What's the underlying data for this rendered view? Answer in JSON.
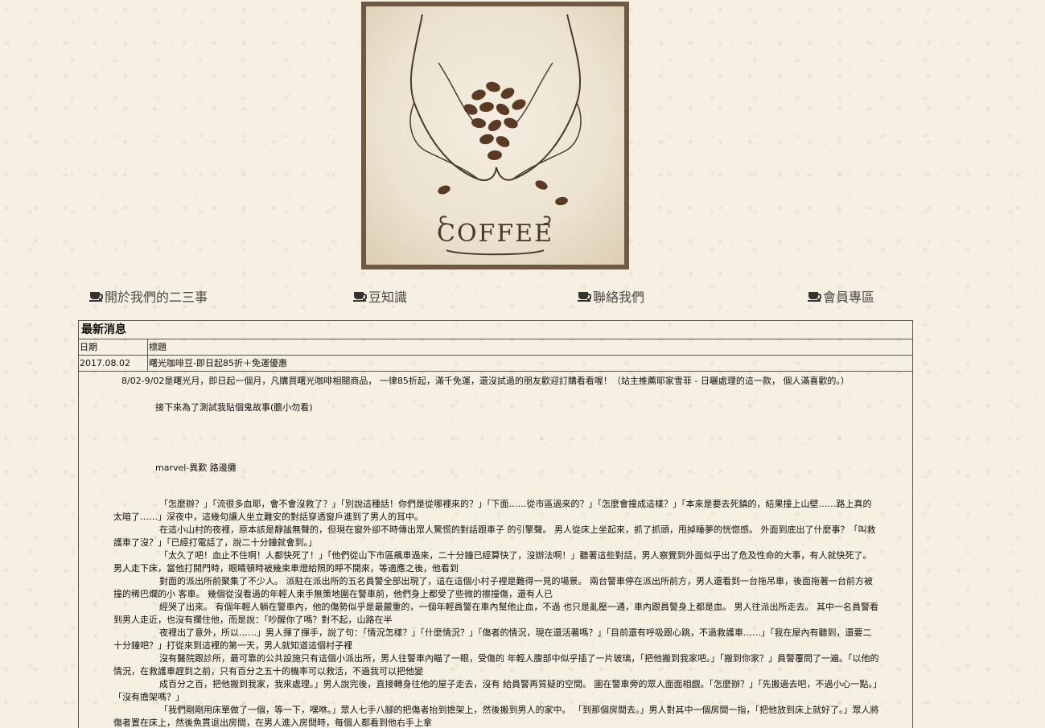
{
  "banner": {
    "text": "COFFEE"
  },
  "nav": {
    "items": [
      {
        "label": "開於我們的二三事"
      },
      {
        "label": "豆知識"
      },
      {
        "label": "聯絡我們"
      },
      {
        "label": "會員專區"
      }
    ]
  },
  "news": {
    "title": "最新消息",
    "columns": {
      "date": "日期",
      "title": "標題"
    },
    "rows": [
      {
        "date": "2017.08.02",
        "title": "曙光咖啡豆-即日起85折＋免運優惠"
      }
    ],
    "intro": "8/02-9/02是曙光月，即日起一個月，凡購買曙光咖啡相關商品， 一律85折起，滿千免運，還沒試過的朋友歡迎訂購看看喔！（站主推薦耶家雪菲 - 日曬處理的這一款， 個人滿喜歡的。）",
    "test_line": "接下來為了測試我貼個鬼故事(膽小勿看)",
    "story_title": "marvel-異歎 路邊攤",
    "story": [
      "「怎麼辦？」「流很多血耶，會不會沒救了？」「別說這種話！你們是從哪裡來的？」「下面……從市區過來的？」「怎麼會撞成這樣？」「本來是要去死鎮的，結果撞上山壁……路上真的太暗了……」深夜中，這幾句讓人坐立難安的對話穿透窗戶進到了男人的耳中。",
      "在這小山村的夜裡，原本該是靜謐無聲的，但現在窗外卻不時傳出眾人驚慌的對話跟車子 的引擎聲。 男人從床上坐起來，抓了抓頭，甩掉睡夢的恍惚感。 外面到底出了什麼事？「叫救護車了沒？」「已經打電話了，說二十分鐘就會到。」",
      "「太久了吧！血止不住啊！人都快死了！」「他們從山下市區飆車過來，二十分鐘已經算快了，沒辦法啊！」聽著這些對話，男人察覺到外面似乎出了危及性命的大事，有人就快死了。 男人走下床，當他打開門時，眼睛頓時被幾束車燈給照的睜不開來，等適應之後，他看到",
      "對面的派出所前聚集了不少人。 派駐在派出所的五名員警全部出現了，這在這個小村子裡是難得一見的場景。 兩台警車停在派出所前方，男人還看到一台拖吊車，後面拖著一台前方被撞的稀巴爛的小 客車。 幾個從沒看過的年輕人束手無策地圍在警車前，他們身上都受了些微的擦撞傷，還有人已",
      "經哭了出來。 有個年輕人躺在警車內，他的傷勢似乎是最嚴重的，一個年輕員警在車內幫他止血，不過 也只是亂壓一通，車內跟員警身上都是血。 男人往派出所走去。 其中一名員警看到男人走近，也沒有攔住他，而是說：「吵醒你了嗎？對不起，山路在半",
      "夜裡出了意外，所以……」男人揮了揮手，說了句：「情況怎樣？」「什麼情況？」「傷者的情況，現在還活著嗎？」「目前還有呼吸跟心跳，不過救護車……」「我在屋內有聽到，還要二十分鐘吧？」打從來到這裡的第一天，男人就知道這個村子裡",
      "沒有醫院跟診所，最可靠的公共設施只有這個小派出所，男人往警車內瞄了一眼，受傷的 年輕人腹部中似乎插了一片玻璃，「把他搬到我家吧。」「搬到你家？」員警覆問了一遍。「以他的情況，在救護車趕到之前，只有百分之五十的機率可以救活，不過我可以把他變",
      "成百分之百，把他搬到我家，我來處理。」男人說完後，直接轉身往他的屋子走去，沒有 給員警再質疑的空間。 圍在警車旁的眾人面面相覷。「怎麼辦？」「先搬過去吧，不過小心一點。」「沒有擔架嗎？」",
      "「我們剛剛用床單做了一個，等一下，嘿咻。」眾人七手八腳的把傷者抬到擔架上，然後搬到男人的家中。 「到那個房間去。」男人對其中一個房間一指，「把他放到床上就好了。」眾人將傷者置在床上，然後魚貫退出房間，在男人進入房間時，每個人都看到他右手上拿"
    ]
  }
}
